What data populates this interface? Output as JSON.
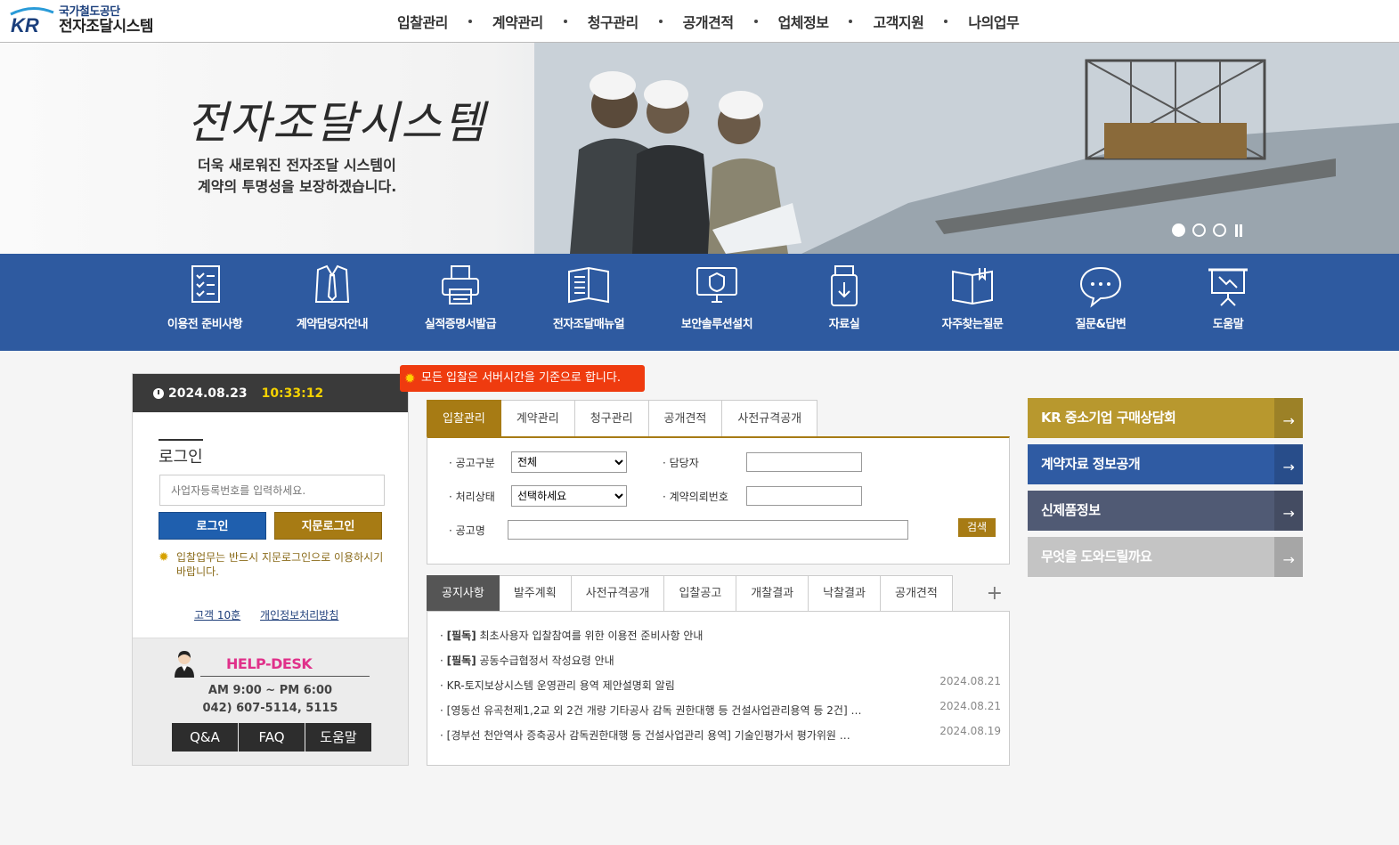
{
  "logo": {
    "sub": "국가철도공단",
    "main": "전자조달시스템"
  },
  "gnb": [
    "입찰관리",
    "계약관리",
    "청구관리",
    "공개견적",
    "업체정보",
    "고객지원",
    "나의업무"
  ],
  "banner": {
    "title": "전자조달시스템",
    "desc_line1": "더욱 새로워진 전자조달 시스템이",
    "desc_line2": "계약의 투명성을 보장하겠습니다."
  },
  "quick_menu": [
    {
      "label": "이용전 준비사항",
      "icon": "checklist-icon"
    },
    {
      "label": "계약담당자안내",
      "icon": "necktie-icon"
    },
    {
      "label": "실적증명서발급",
      "icon": "printer-icon"
    },
    {
      "label": "전자조달매뉴얼",
      "icon": "book-icon"
    },
    {
      "label": "보안솔루션설치",
      "icon": "monitor-shield-icon"
    },
    {
      "label": "자료실",
      "icon": "usb-icon"
    },
    {
      "label": "자주찾는질문",
      "icon": "open-book-icon"
    },
    {
      "label": "질문&답변",
      "icon": "chat-icon"
    },
    {
      "label": "도움말",
      "icon": "presentation-icon"
    }
  ],
  "clock": {
    "date": "2024.08.23",
    "time": "10:33:12"
  },
  "login": {
    "title": "로그인",
    "placeholder": "사업자등록번호를 입력하세요.",
    "login_btn": "로그인",
    "finger_btn": "지문로그인",
    "note": "입찰업무는 반드시 지문로그인으로 이용하시기 바랍니다.",
    "links": [
      "고객 10훈",
      "개인정보처리방침"
    ]
  },
  "helpdesk": {
    "title": "HELP-DESK",
    "hours": "AM 9:00 ~ PM 6:00",
    "phone": "042) 607-5114, 5115",
    "buttons": [
      "Q&A",
      "FAQ",
      "도움말"
    ]
  },
  "server_notice": "모든 입찰은 서버시간을 기준으로 합니다.",
  "search_tabs": [
    "입찰관리",
    "계약관리",
    "청구관리",
    "공개견적",
    "사전규격공개"
  ],
  "search_form": {
    "label_type": "· 공고구분",
    "type_value": "전체",
    "label_manager": "· 담당자",
    "label_status": "· 처리상태",
    "status_value": "선택하세요",
    "label_contract_no": "· 계약의뢰번호",
    "label_name": "· 공고명",
    "search_btn": "검색"
  },
  "board_tabs": [
    "공지사항",
    "발주계획",
    "사전규격공개",
    "입찰공고",
    "개찰결과",
    "낙찰결과",
    "공개견적"
  ],
  "notices": [
    {
      "prefix": "· ",
      "bold": "[필독]",
      "text": " 최초사용자 입찰참여를 위한 이용전 준비사항 안내",
      "date": ""
    },
    {
      "prefix": "· ",
      "bold": "[필독]",
      "text": " 공동수급협정서 작성요령 안내",
      "date": ""
    },
    {
      "prefix": "· ",
      "bold": "",
      "text": "KR-토지보상시스템 운영관리 용역 제안설명회 알림",
      "date": "2024.08.21"
    },
    {
      "prefix": "· ",
      "bold": "",
      "text": "[영동선 유곡천제1,2교 외 2건 개량 기타공사 감독 권한대행 등 건설사업관리용역 등 2건] …",
      "date": "2024.08.21"
    },
    {
      "prefix": "· ",
      "bold": "",
      "text": "[경부선 천안역사 증축공사 감독권한대행 등 건설사업관리 용역] 기술인평가서 평가위원 …",
      "date": "2024.08.19"
    }
  ],
  "right_links": [
    {
      "label": "KR 중소기업 구매상담회",
      "color": "#b8982e"
    },
    {
      "label": "계약자료 정보공개",
      "color": "#2f5ba3"
    },
    {
      "label": "신제품정보",
      "color": "#505a74"
    },
    {
      "label": "무엇을 도와드릴까요",
      "color": "#c4c4c4"
    }
  ],
  "colors": {
    "brand_blue": "#2e5aa0",
    "gold": "#a77b14",
    "notice_red": "#ef3b0f",
    "clock_yellow": "#f5d200"
  }
}
